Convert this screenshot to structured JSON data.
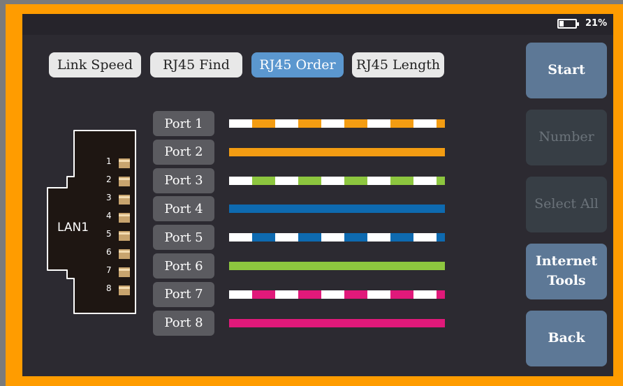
{
  "status": {
    "battery_pct": "21%"
  },
  "tabs": [
    {
      "label": "Link Speed",
      "active": false
    },
    {
      "label": "RJ45 Find",
      "active": false
    },
    {
      "label": "RJ45 Order",
      "active": true
    },
    {
      "label": "RJ45 Length",
      "active": false
    }
  ],
  "connector": {
    "label": "LAN1",
    "pins": [
      "1",
      "2",
      "3",
      "4",
      "5",
      "6",
      "7",
      "8"
    ]
  },
  "ports": [
    {
      "label": "Port 1",
      "color": "#f39c12",
      "striped": true
    },
    {
      "label": "Port 2",
      "color": "#f39c12",
      "striped": false
    },
    {
      "label": "Port 3",
      "color": "#8dc63f",
      "striped": true
    },
    {
      "label": "Port 4",
      "color": "#0e6ab0",
      "striped": false
    },
    {
      "label": "Port 5",
      "color": "#0e6ab0",
      "striped": true
    },
    {
      "label": "Port 6",
      "color": "#8dc63f",
      "striped": false
    },
    {
      "label": "Port 7",
      "color": "#e0197a",
      "striped": true
    },
    {
      "label": "Port 8",
      "color": "#e0197a",
      "striped": false
    }
  ],
  "side_buttons": {
    "start": "Start",
    "number": "Number",
    "select_all": "Select All",
    "internet_tools_line1": "Internet",
    "internet_tools_line2": "Tools",
    "back": "Back"
  }
}
